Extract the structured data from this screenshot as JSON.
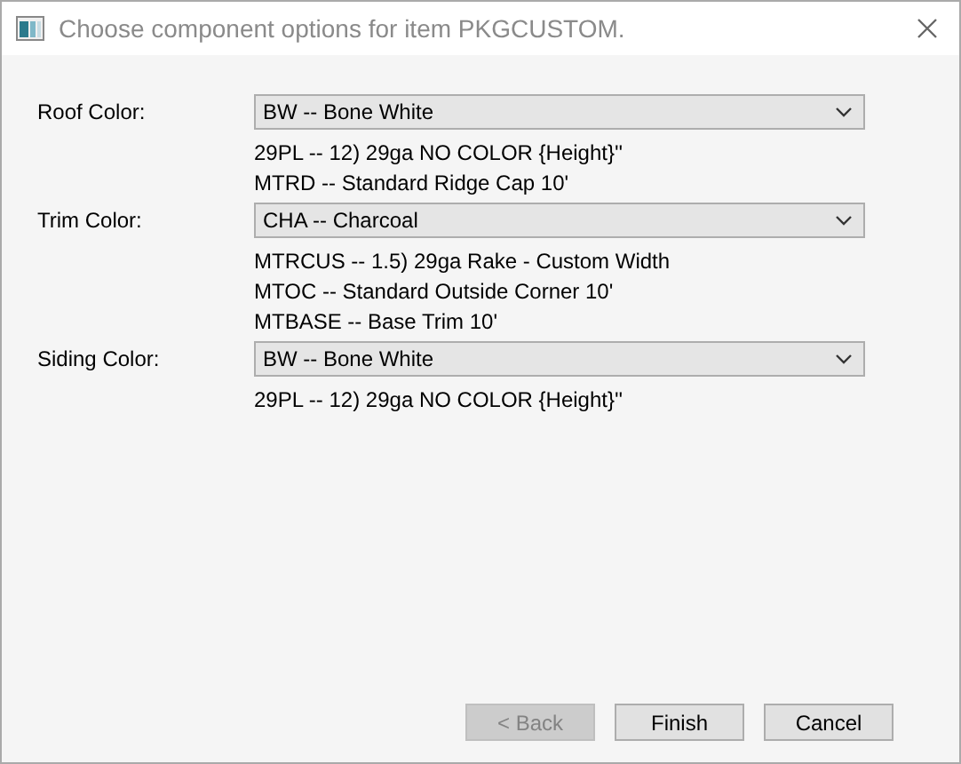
{
  "window": {
    "title": "Choose component options for item PKGCUSTOM."
  },
  "options": [
    {
      "label": "Roof Color:",
      "value": "BW -- Bone White",
      "components": [
        "29PL -- 12) 29ga NO COLOR {Height}''",
        "MTRD -- Standard Ridge Cap 10'"
      ]
    },
    {
      "label": "Trim Color:",
      "value": "CHA -- Charcoal",
      "components": [
        "MTRCUS -- 1.5) 29ga Rake - Custom Width",
        "MTOC -- Standard Outside Corner 10'",
        "MTBASE -- Base Trim 10'"
      ]
    },
    {
      "label": "Siding Color:",
      "value": "BW -- Bone White",
      "components": [
        "29PL -- 12) 29ga NO COLOR {Height}''"
      ]
    }
  ],
  "buttons": [
    {
      "label": "< Back",
      "disabled": true
    },
    {
      "label": "Finish",
      "disabled": false
    },
    {
      "label": "Cancel",
      "disabled": false
    }
  ]
}
